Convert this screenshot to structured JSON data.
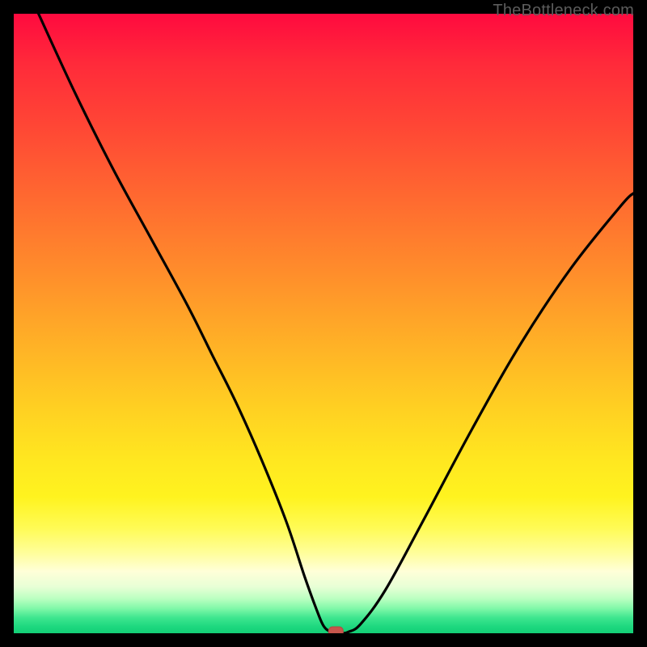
{
  "watermark": {
    "text": "TheBottleneck.com"
  },
  "colors": {
    "frame": "#000000",
    "curve_stroke": "#000000",
    "marker_fill": "#c6564c",
    "marker_stroke": "#b34a41"
  },
  "chart_data": {
    "type": "line",
    "title": "",
    "xlabel": "",
    "ylabel": "",
    "xlim": [
      0,
      100
    ],
    "ylim": [
      0,
      100
    ],
    "grid": false,
    "legend": false,
    "annotations": [],
    "marker": {
      "x": 52,
      "y": 0
    },
    "series": [
      {
        "name": "bottleneck-curve",
        "x": [
          4,
          10,
          16,
          22,
          28,
          32,
          36,
          40,
          44,
          47,
          49,
          50,
          51,
          52,
          53,
          54,
          56,
          60,
          66,
          74,
          82,
          90,
          98,
          100
        ],
        "y": [
          100,
          87,
          75,
          64,
          53,
          45,
          37,
          28,
          18,
          9,
          3.5,
          1.2,
          0.3,
          0,
          0,
          0.2,
          1.5,
          7,
          18,
          33,
          47,
          59,
          69,
          71
        ]
      }
    ]
  }
}
